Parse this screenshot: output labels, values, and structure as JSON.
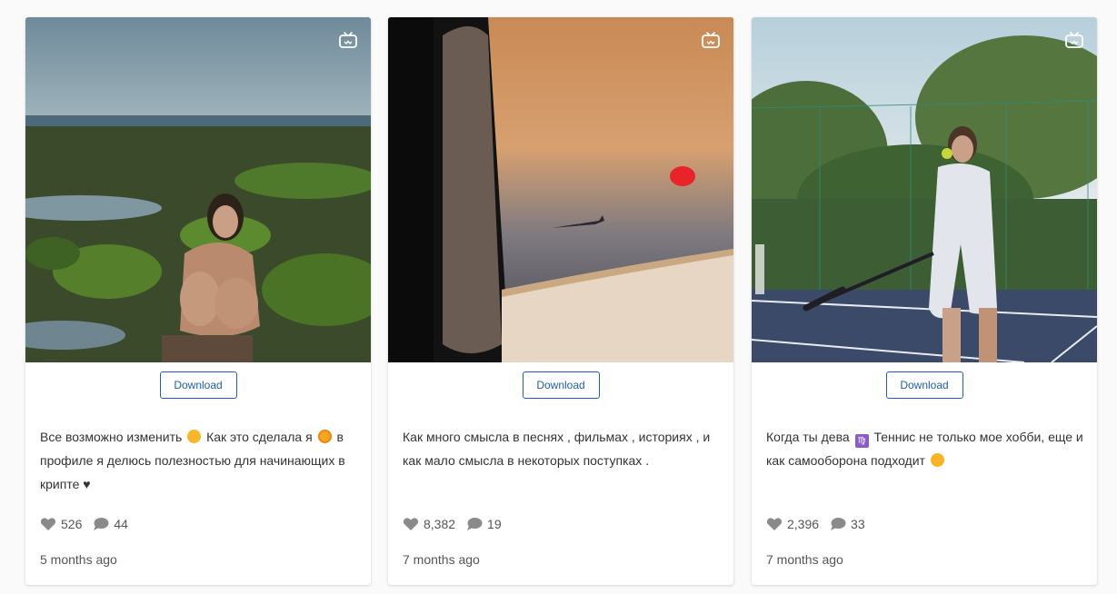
{
  "download_label": "Download",
  "posts": [
    {
      "caption_1": "Все возможно изменить",
      "caption_2": "Как это сделала я",
      "caption_3": "в профиле я делюсь полезностью для начинающих в крипте ♥",
      "likes": "526",
      "comments": "44",
      "time": "5 months ago"
    },
    {
      "caption_1": "Как много смысла в песнях , фильмах , историях , и как мало смысла в некоторых поступках .",
      "likes": "8,382",
      "comments": "19",
      "time": "7 months ago"
    },
    {
      "caption_1": "Когда ты дева",
      "caption_2": "Теннис не только мое хобби, еще и как самооборона подходит",
      "likes": "2,396",
      "comments": "33",
      "time": "7 months ago"
    }
  ],
  "icons": {
    "media_badge": "tv-icon",
    "likes": "heart-icon",
    "comments": "comment-icon"
  },
  "colors": {
    "accent": "#1f5fa8",
    "text": "#333333",
    "muted": "#555555",
    "icon": "#8a8a8a"
  }
}
